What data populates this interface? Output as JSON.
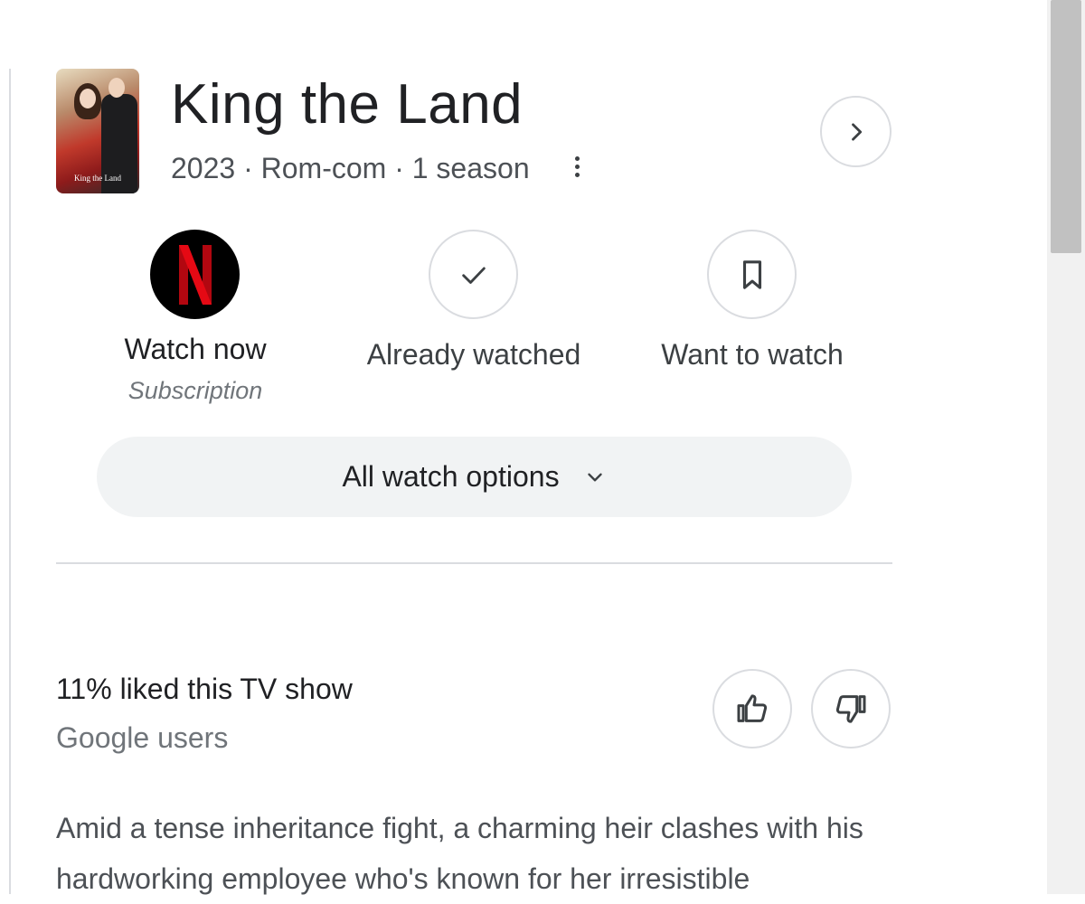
{
  "show": {
    "title": "King the Land",
    "meta": "2023 · Rom-com · 1 season",
    "poster_text": "King the Land"
  },
  "actions": {
    "watch_now": {
      "label": "Watch now",
      "sub": "Subscription",
      "provider_icon": "netflix-logo-icon",
      "provider_color": "#E50914"
    },
    "already_watched": {
      "label": "Already watched",
      "icon": "checkmark-icon"
    },
    "want_to_watch": {
      "label": "Want to watch",
      "icon": "bookmark-icon"
    }
  },
  "watch_options": {
    "label": "All watch options",
    "icon": "chevron-down-icon"
  },
  "rating": {
    "liked_text": "11% liked this TV show",
    "source": "Google users",
    "liked_percent": 11
  },
  "description": "Amid a tense inheritance fight, a charming heir clashes with his hardworking employee who's known for her irresistible",
  "colors": {
    "accent_red": "#E50914",
    "text": "#202124",
    "muted": "#70757a",
    "border": "#dadce0",
    "pill_bg": "#f1f3f4"
  }
}
